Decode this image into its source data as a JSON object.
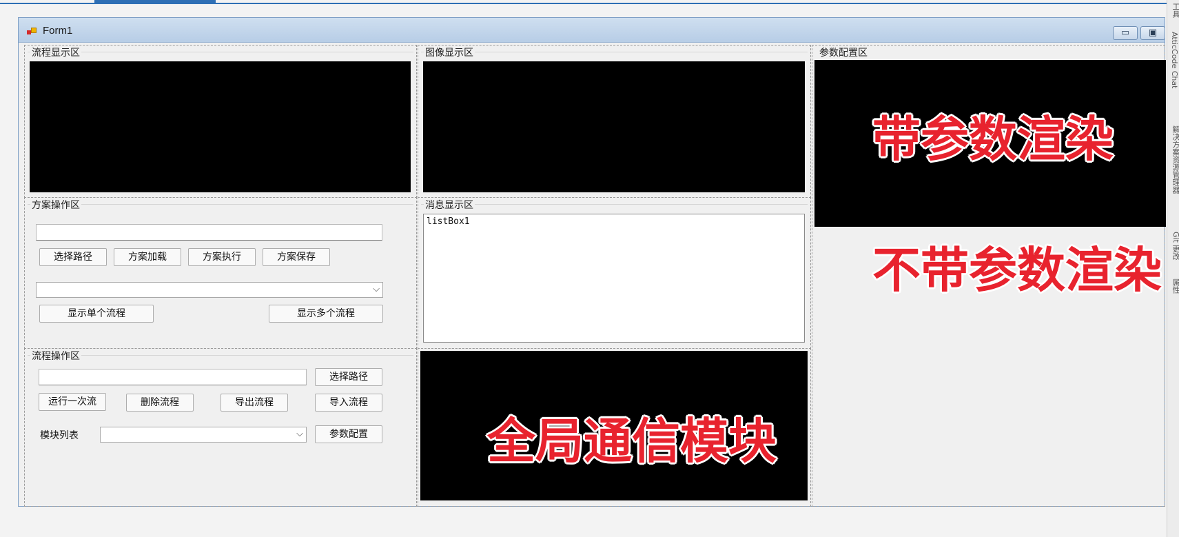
{
  "window": {
    "title": "Form1",
    "minimize_label": "▭",
    "maximize_label": "▣"
  },
  "process_display": {
    "label": "流程显示区"
  },
  "image_display": {
    "label": "图像显示区"
  },
  "param_config": {
    "label": "参数配置区",
    "overlay_top": "带参数渲染",
    "overlay_bottom": "不带参数渲染"
  },
  "scheme_ops": {
    "label": "方案操作区",
    "path_value": "",
    "buttons": {
      "select_path": "选择路径",
      "load": "方案加载",
      "execute": "方案执行",
      "save": "方案保存"
    },
    "combo_value": "",
    "show_single": "显示单个流程",
    "show_multiple": "显示多个流程"
  },
  "message_display": {
    "label": "消息显示区",
    "listbox_text": "listBox1"
  },
  "process_ops": {
    "label": "流程操作区",
    "path_value": "",
    "buttons": {
      "select_path": "选择路径",
      "run_once": "运行一次流",
      "delete": "删除流程",
      "export": "导出流程",
      "import": "导入流程",
      "param_config": "参数配置"
    },
    "module_list_label": "模块列表",
    "module_combo_value": ""
  },
  "comm_module": {
    "overlay": "全局通信模块"
  },
  "side_gutter": {
    "texts": [
      "工具",
      "AtticCode Chat",
      "解决方案资源管理器",
      "Git 更改",
      "属性"
    ]
  }
}
